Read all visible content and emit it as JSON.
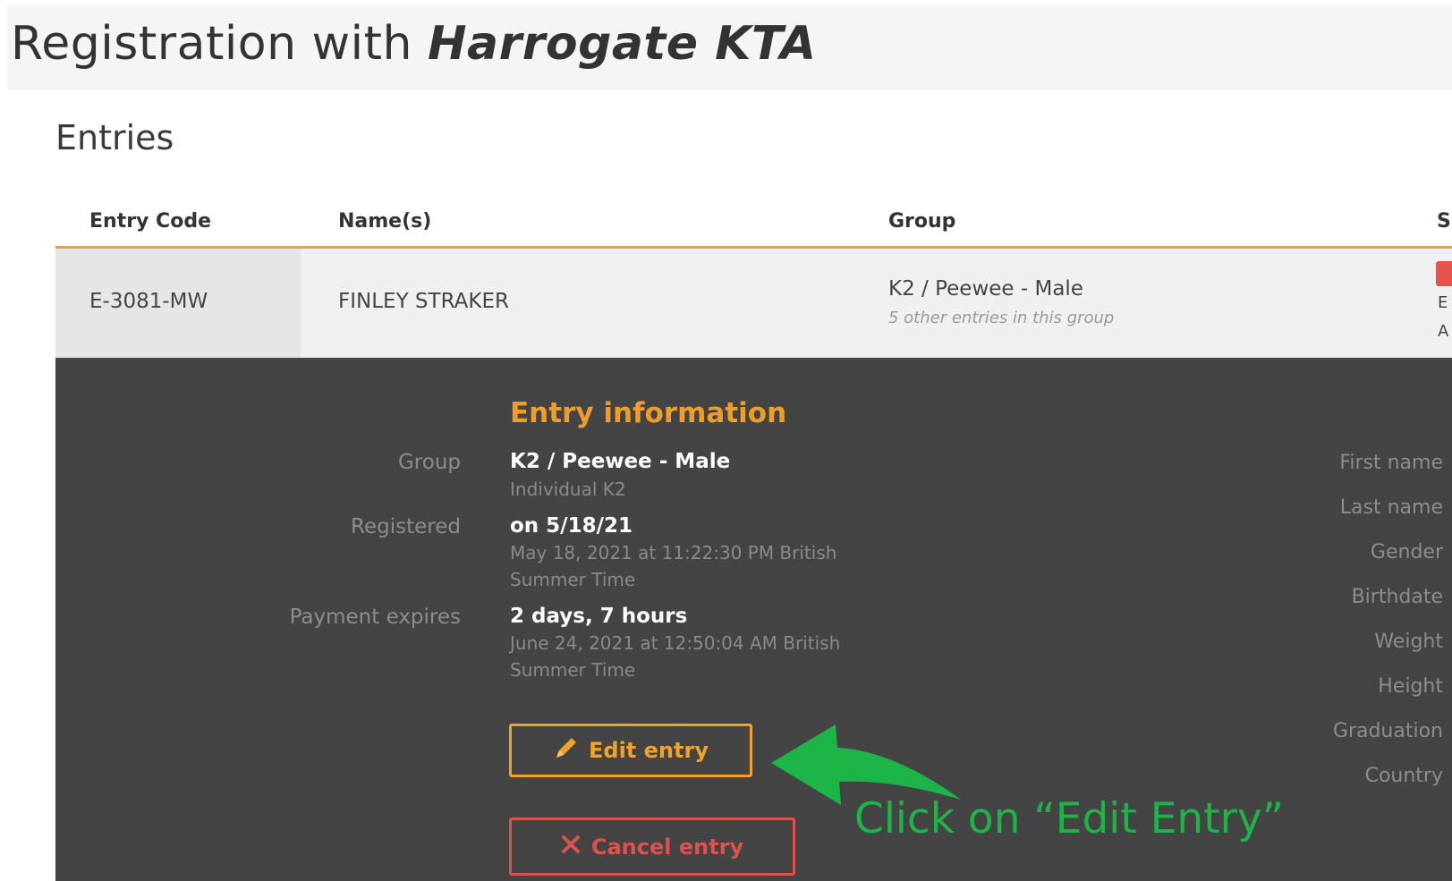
{
  "page": {
    "title_prefix": "Registration with",
    "title_org": "Harrogate KTA"
  },
  "entries": {
    "section_title": "Entries",
    "columns": [
      "Entry Code",
      "Name(s)",
      "Group",
      "S"
    ],
    "row": {
      "code": "E-3081-MW",
      "name": "FINLEY STRAKER",
      "group": "K2 / Peewee - Male",
      "group_note": "5 other entries in this group",
      "status_line1": "E",
      "status_line2": "A"
    }
  },
  "entry_info": {
    "heading": "Entry information",
    "group_label": "Group",
    "group_value": "K2 / Peewee - Male",
    "group_sub": "Individual K2",
    "registered_label": "Registered",
    "registered_value": "on 5/18/21",
    "registered_sub1": "May 18, 2021 at 11:22:30 PM British",
    "registered_sub2": "Summer Time",
    "payment_label": "Payment expires",
    "payment_value": "2 days, 7 hours",
    "payment_sub1": "June 24, 2021 at 12:50:04 AM British",
    "payment_sub2": "Summer Time"
  },
  "right_labels": [
    "First name",
    "Last name",
    "Gender",
    "Birthdate",
    "Weight",
    "Height",
    "Graduation",
    "Country"
  ],
  "buttons": {
    "edit": "Edit entry",
    "cancel": "Cancel entry"
  },
  "icons": {
    "edit": "pencil-icon",
    "cancel": "x-icon",
    "annotation": "green-arrow-icon"
  },
  "annotation": {
    "text": "Click on “Edit Entry”",
    "color": "#1db548"
  },
  "colors": {
    "accent": "#f0a32b",
    "danger": "#d9534f",
    "dark_panel": "#444444"
  }
}
